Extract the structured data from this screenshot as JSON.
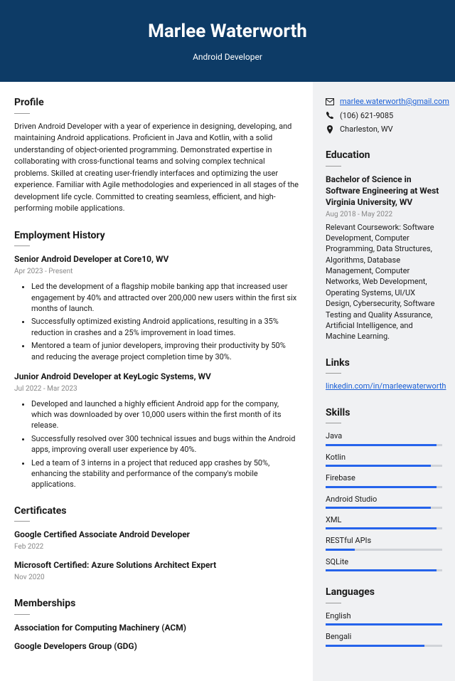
{
  "header": {
    "name": "Marlee Waterworth",
    "title": "Android Developer"
  },
  "profile": {
    "heading": "Profile",
    "text": "Driven Android Developer with a year of experience in designing, developing, and maintaining Android applications. Proficient in Java and Kotlin, with a solid understanding of object-oriented programming. Demonstrated expertise in collaborating with cross-functional teams and solving complex technical problems. Skilled at creating user-friendly interfaces and optimizing the user experience. Familiar with Agile methodologies and experienced in all stages of the development life cycle. Committed to creating seamless, efficient, and high-performing mobile applications."
  },
  "employment": {
    "heading": "Employment History",
    "jobs": [
      {
        "title": "Senior Android Developer at Core10, WV",
        "date": "Apr 2023 - Present",
        "bullets": [
          "Led the development of a flagship mobile banking app that increased user engagement by 40% and attracted over 200,000 new users within the first six months of launch.",
          "Successfully optimized existing Android applications, resulting in a 35% reduction in crashes and a 25% improvement in load times.",
          "Mentored a team of junior developers, improving their productivity by 50% and reducing the average project completion time by 30%."
        ]
      },
      {
        "title": "Junior Android Developer at KeyLogic Systems, WV",
        "date": "Jul 2022 - Mar 2023",
        "bullets": [
          "Developed and launched a highly efficient Android app for the company, which was downloaded by over 10,000 users within the first month of its release.",
          "Successfully resolved over 300 technical issues and bugs within the Android apps, improving overall user experience by 40%.",
          "Led a team of 3 interns in a project that reduced app crashes by 50%, enhancing the stability and performance of the company's mobile applications."
        ]
      }
    ]
  },
  "certificates": {
    "heading": "Certificates",
    "items": [
      {
        "title": "Google Certified Associate Android Developer",
        "date": "Feb 2022"
      },
      {
        "title": "Microsoft Certified: Azure Solutions Architect Expert",
        "date": "Nov 2020"
      }
    ]
  },
  "memberships": {
    "heading": "Memberships",
    "items": [
      "Association for Computing Machinery (ACM)",
      "Google Developers Group (GDG)"
    ]
  },
  "contact": {
    "email": "marlee.waterworth@gmail.com",
    "phone": "(106) 621-9085",
    "location": "Charleston, WV"
  },
  "education": {
    "heading": "Education",
    "title": "Bachelor of Science in Software Engineering at West Virginia University, WV",
    "date": "Aug 2018 - May 2022",
    "desc": "Relevant Coursework: Software Development, Computer Programming, Data Structures, Algorithms, Database Management, Computer Networks, Web Development, Operating Systems, UI/UX Design, Cybersecurity, Software Testing and Quality Assurance, Artificial Intelligence, and Machine Learning."
  },
  "links": {
    "heading": "Links",
    "items": [
      "linkedin.com/in/marleewaterworth"
    ]
  },
  "skills": {
    "heading": "Skills",
    "items": [
      {
        "name": "Java",
        "level": 95
      },
      {
        "name": "Kotlin",
        "level": 90
      },
      {
        "name": "Firebase",
        "level": 95
      },
      {
        "name": "Android Studio",
        "level": 90
      },
      {
        "name": "XML",
        "level": 95
      },
      {
        "name": "RESTful APIs",
        "level": 25
      },
      {
        "name": "SQLite",
        "level": 95
      }
    ]
  },
  "languages": {
    "heading": "Languages",
    "items": [
      {
        "name": "English",
        "level": 100
      },
      {
        "name": "Bengali",
        "level": 85
      }
    ]
  }
}
